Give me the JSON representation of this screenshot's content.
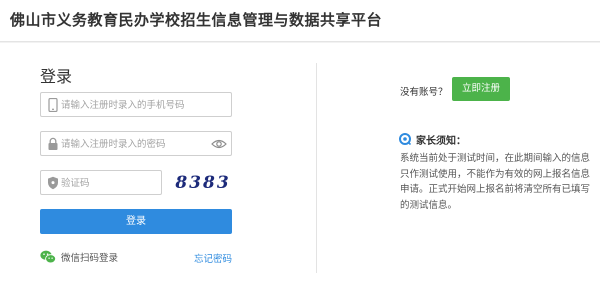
{
  "header": {
    "site_title": "佛山市义务教育民办学校招生信息管理与数据共享平台"
  },
  "login": {
    "title": "登录",
    "phone_placeholder": "请输入注册时录入的手机号码",
    "password_placeholder": "请输入注册时录入的密码",
    "captcha_placeholder": "验证码",
    "captcha_code": "8383",
    "login_button": "登录",
    "wechat_login": "微信扫码登录",
    "forgot_password": "忘记密码"
  },
  "register": {
    "prompt": "没有账号？",
    "button": "立即注册"
  },
  "notice": {
    "title": "家长须知：",
    "body": "系统当前处于测试时间，在此期间输入的信息只作测试使用，不能作为有效的网上报名信息申请。正式开始网上报名前将清空所有已填写的测试信息。"
  },
  "colors": {
    "primary_blue": "#2f8bdf",
    "register_green": "#4cb34a",
    "notice_icon_blue": "#2f8bdf"
  },
  "icons": {
    "phone": "phone-icon",
    "lock": "lock-icon",
    "eye": "eye-icon",
    "shield": "shield-icon",
    "wechat": "wechat-icon",
    "notice": "notice-icon"
  }
}
